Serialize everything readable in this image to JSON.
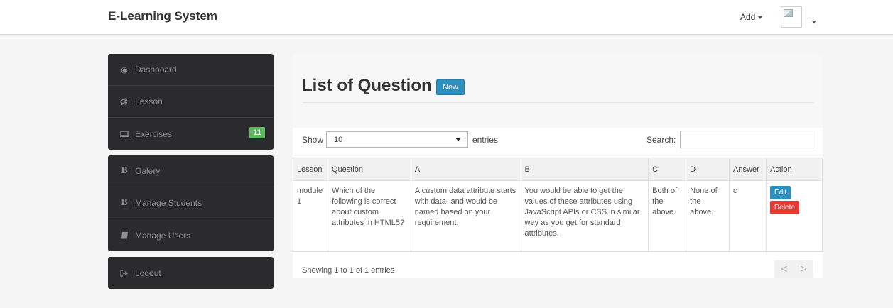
{
  "app": {
    "brand": "E-Learning System"
  },
  "topnav": {
    "add_label": "Add"
  },
  "sidebar": {
    "group1": [
      {
        "icon": "dashboard-icon",
        "label": "Dashboard"
      },
      {
        "icon": "bullhorn-icon",
        "label": "Lesson"
      },
      {
        "icon": "monitor-icon",
        "label": "Exercises",
        "badge": "11"
      }
    ],
    "group2": [
      {
        "icon": "bootstrap-b-icon",
        "label": "Galery"
      },
      {
        "icon": "bootstrap-b-icon",
        "label": "Manage Students"
      },
      {
        "icon": "book-icon",
        "label": "Manage Users"
      }
    ],
    "group3": [
      {
        "icon": "sign-out-icon",
        "label": "Logout"
      }
    ],
    "badge_color": "#5cb85c"
  },
  "page": {
    "title": "List of Question",
    "new_button": "New",
    "show_label": "Show",
    "entries_value": "10",
    "entries_label": "entries",
    "search_label": "Search:",
    "search_value": "",
    "info": "Showing 1 to 1 of 1 entries",
    "pager": {
      "prev": "<",
      "next": ">"
    }
  },
  "table": {
    "headers": [
      "Lesson",
      "Question",
      "A",
      "B",
      "C",
      "D",
      "Answer",
      "Action"
    ],
    "rows": [
      {
        "lesson": "module 1",
        "question": "Which of the following is correct about custom attributes in HTML5?",
        "a": "A custom data attribute starts with data- and would be named based on your requirement.",
        "b": "You would be able to get the values of these attributes using JavaScript APIs or CSS in similar way as you get for standard attributes.",
        "c": "Both of the above.",
        "d": "None of the above.",
        "answer": "c",
        "edit": "Edit",
        "delete": "Delete"
      }
    ]
  },
  "colors": {
    "primary": "#2c8fbd",
    "danger": "#e53935",
    "sidebar_bg": "#2b2b2e"
  }
}
